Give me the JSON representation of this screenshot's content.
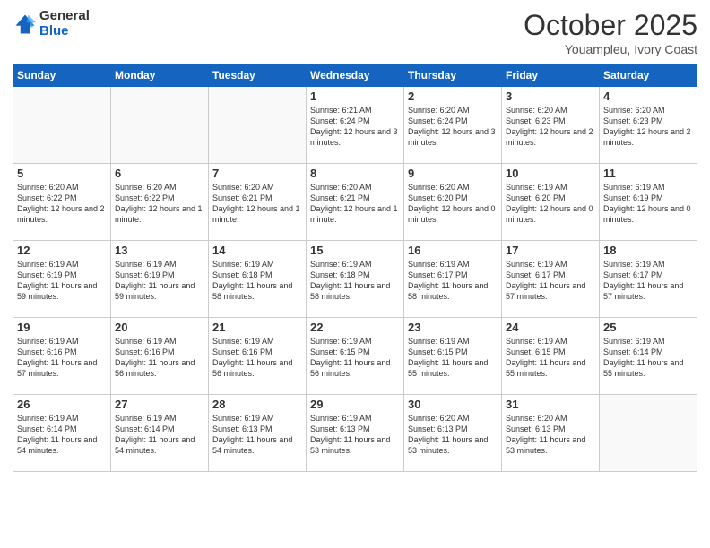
{
  "logo": {
    "general": "General",
    "blue": "Blue"
  },
  "title": {
    "month": "October 2025",
    "location": "Youampleu, Ivory Coast"
  },
  "headers": [
    "Sunday",
    "Monday",
    "Tuesday",
    "Wednesday",
    "Thursday",
    "Friday",
    "Saturday"
  ],
  "weeks": [
    [
      {
        "day": "",
        "info": ""
      },
      {
        "day": "",
        "info": ""
      },
      {
        "day": "",
        "info": ""
      },
      {
        "day": "1",
        "info": "Sunrise: 6:21 AM\nSunset: 6:24 PM\nDaylight: 12 hours and 3 minutes."
      },
      {
        "day": "2",
        "info": "Sunrise: 6:20 AM\nSunset: 6:24 PM\nDaylight: 12 hours and 3 minutes."
      },
      {
        "day": "3",
        "info": "Sunrise: 6:20 AM\nSunset: 6:23 PM\nDaylight: 12 hours and 2 minutes."
      },
      {
        "day": "4",
        "info": "Sunrise: 6:20 AM\nSunset: 6:23 PM\nDaylight: 12 hours and 2 minutes."
      }
    ],
    [
      {
        "day": "5",
        "info": "Sunrise: 6:20 AM\nSunset: 6:22 PM\nDaylight: 12 hours and 2 minutes."
      },
      {
        "day": "6",
        "info": "Sunrise: 6:20 AM\nSunset: 6:22 PM\nDaylight: 12 hours and 1 minute."
      },
      {
        "day": "7",
        "info": "Sunrise: 6:20 AM\nSunset: 6:21 PM\nDaylight: 12 hours and 1 minute."
      },
      {
        "day": "8",
        "info": "Sunrise: 6:20 AM\nSunset: 6:21 PM\nDaylight: 12 hours and 1 minute."
      },
      {
        "day": "9",
        "info": "Sunrise: 6:20 AM\nSunset: 6:20 PM\nDaylight: 12 hours and 0 minutes."
      },
      {
        "day": "10",
        "info": "Sunrise: 6:19 AM\nSunset: 6:20 PM\nDaylight: 12 hours and 0 minutes."
      },
      {
        "day": "11",
        "info": "Sunrise: 6:19 AM\nSunset: 6:19 PM\nDaylight: 12 hours and 0 minutes."
      }
    ],
    [
      {
        "day": "12",
        "info": "Sunrise: 6:19 AM\nSunset: 6:19 PM\nDaylight: 11 hours and 59 minutes."
      },
      {
        "day": "13",
        "info": "Sunrise: 6:19 AM\nSunset: 6:19 PM\nDaylight: 11 hours and 59 minutes."
      },
      {
        "day": "14",
        "info": "Sunrise: 6:19 AM\nSunset: 6:18 PM\nDaylight: 11 hours and 58 minutes."
      },
      {
        "day": "15",
        "info": "Sunrise: 6:19 AM\nSunset: 6:18 PM\nDaylight: 11 hours and 58 minutes."
      },
      {
        "day": "16",
        "info": "Sunrise: 6:19 AM\nSunset: 6:17 PM\nDaylight: 11 hours and 58 minutes."
      },
      {
        "day": "17",
        "info": "Sunrise: 6:19 AM\nSunset: 6:17 PM\nDaylight: 11 hours and 57 minutes."
      },
      {
        "day": "18",
        "info": "Sunrise: 6:19 AM\nSunset: 6:17 PM\nDaylight: 11 hours and 57 minutes."
      }
    ],
    [
      {
        "day": "19",
        "info": "Sunrise: 6:19 AM\nSunset: 6:16 PM\nDaylight: 11 hours and 57 minutes."
      },
      {
        "day": "20",
        "info": "Sunrise: 6:19 AM\nSunset: 6:16 PM\nDaylight: 11 hours and 56 minutes."
      },
      {
        "day": "21",
        "info": "Sunrise: 6:19 AM\nSunset: 6:16 PM\nDaylight: 11 hours and 56 minutes."
      },
      {
        "day": "22",
        "info": "Sunrise: 6:19 AM\nSunset: 6:15 PM\nDaylight: 11 hours and 56 minutes."
      },
      {
        "day": "23",
        "info": "Sunrise: 6:19 AM\nSunset: 6:15 PM\nDaylight: 11 hours and 55 minutes."
      },
      {
        "day": "24",
        "info": "Sunrise: 6:19 AM\nSunset: 6:15 PM\nDaylight: 11 hours and 55 minutes."
      },
      {
        "day": "25",
        "info": "Sunrise: 6:19 AM\nSunset: 6:14 PM\nDaylight: 11 hours and 55 minutes."
      }
    ],
    [
      {
        "day": "26",
        "info": "Sunrise: 6:19 AM\nSunset: 6:14 PM\nDaylight: 11 hours and 54 minutes."
      },
      {
        "day": "27",
        "info": "Sunrise: 6:19 AM\nSunset: 6:14 PM\nDaylight: 11 hours and 54 minutes."
      },
      {
        "day": "28",
        "info": "Sunrise: 6:19 AM\nSunset: 6:13 PM\nDaylight: 11 hours and 54 minutes."
      },
      {
        "day": "29",
        "info": "Sunrise: 6:19 AM\nSunset: 6:13 PM\nDaylight: 11 hours and 53 minutes."
      },
      {
        "day": "30",
        "info": "Sunrise: 6:20 AM\nSunset: 6:13 PM\nDaylight: 11 hours and 53 minutes."
      },
      {
        "day": "31",
        "info": "Sunrise: 6:20 AM\nSunset: 6:13 PM\nDaylight: 11 hours and 53 minutes."
      },
      {
        "day": "",
        "info": ""
      }
    ]
  ]
}
